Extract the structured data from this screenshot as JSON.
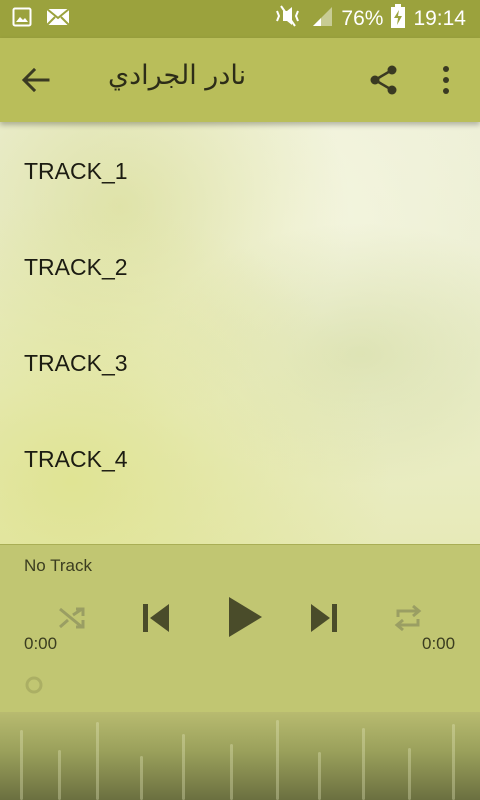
{
  "status_bar": {
    "battery": "76%",
    "time": "19:14",
    "icons": [
      "image-icon",
      "mail-icon",
      "mute-icon",
      "signal-icon",
      "battery-charging-icon"
    ]
  },
  "app_bar": {
    "title": "نادر الجرادي",
    "icons": [
      "back-arrow-icon",
      "share-icon",
      "more-vert-icon"
    ]
  },
  "tracks": [
    {
      "label": "TRACK_1"
    },
    {
      "label": "TRACK_2"
    },
    {
      "label": "TRACK_3"
    },
    {
      "label": "TRACK_4"
    }
  ],
  "player": {
    "now_playing": "No Track",
    "time_current": "0:00",
    "time_total": "0:00",
    "controls": [
      "shuffle-icon",
      "previous-icon",
      "play-icon",
      "next-icon",
      "repeat-icon"
    ]
  },
  "colors": {
    "status_bar": "#9ba23d",
    "app_bar": "#b9be5a",
    "player": "#c1c672",
    "control": "#4a4c2a"
  }
}
